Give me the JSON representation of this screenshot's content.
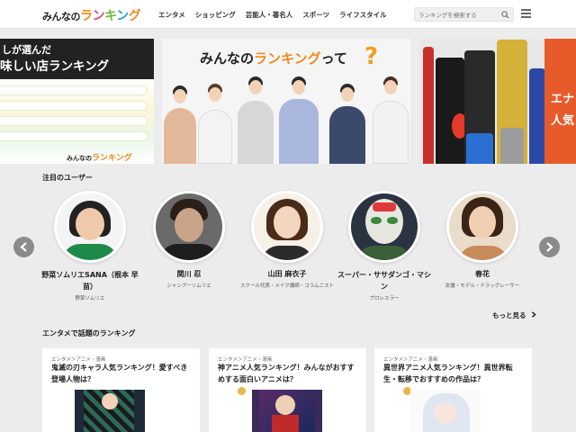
{
  "header": {
    "logo_left": "みんなの",
    "logo_right": "ランキング",
    "nav": [
      "エンタメ",
      "ショッピング",
      "芸能人・著名人",
      "スポーツ",
      "ライフスタイル"
    ],
    "search_placeholder": "ランキングを検索する"
  },
  "banners": {
    "b1_line1": "しが選んだ",
    "b1_line2": "味しい店ランキング",
    "b1_logo_left": "みんなの",
    "b1_logo_right": "ランキング",
    "b2_title_left": "みんなの",
    "b2_title_mid": "ランキング",
    "b2_title_right": "って",
    "b2_q": "?",
    "b3_line1": "エナ",
    "b3_line2": "人気"
  },
  "featured": {
    "title": "注目のユーザー",
    "users": [
      {
        "name": "野菜ソムリエSANA（根本 早苗）",
        "sub": "野菜ソムリエ"
      },
      {
        "name": "関川 忍",
        "sub": "シャンプーソムリエ"
      },
      {
        "name": "山田 麻衣子",
        "sub": "スクール代表・メイク講師・コラムニスト"
      },
      {
        "name": "スーパー・ササダンゴ・マシン",
        "sub": "プロレスラー"
      },
      {
        "name": "春花",
        "sub": "女優・モデル・ドラッグレーサー"
      }
    ],
    "more": "もっと見る"
  },
  "rankings": {
    "title": "エンタメで話題のランキング",
    "cards": [
      {
        "category": "エンタメ＞アニメ・漫画",
        "title": "鬼滅の刃キャラ人気ランキング！愛すべき登場人物は？"
      },
      {
        "category": "エンタメ＞アニメ・漫画",
        "title": "神アニメ人気ランキング！みんながおすすめする面白いアニメは？"
      },
      {
        "category": "エンタメ＞アニメ・漫画",
        "title": "異世界アニメ人気ランキング！異世界転生・転移でおすすめの作品は？"
      }
    ]
  },
  "colors": {
    "logo_orange": "#f08a1c",
    "logo_green": "#6cbb3c",
    "logo_pink": "#e0457a",
    "logo_blue": "#2a9ad6",
    "energy_orange": "#e75b2a",
    "arrow_gray": "#8b8b8b"
  }
}
